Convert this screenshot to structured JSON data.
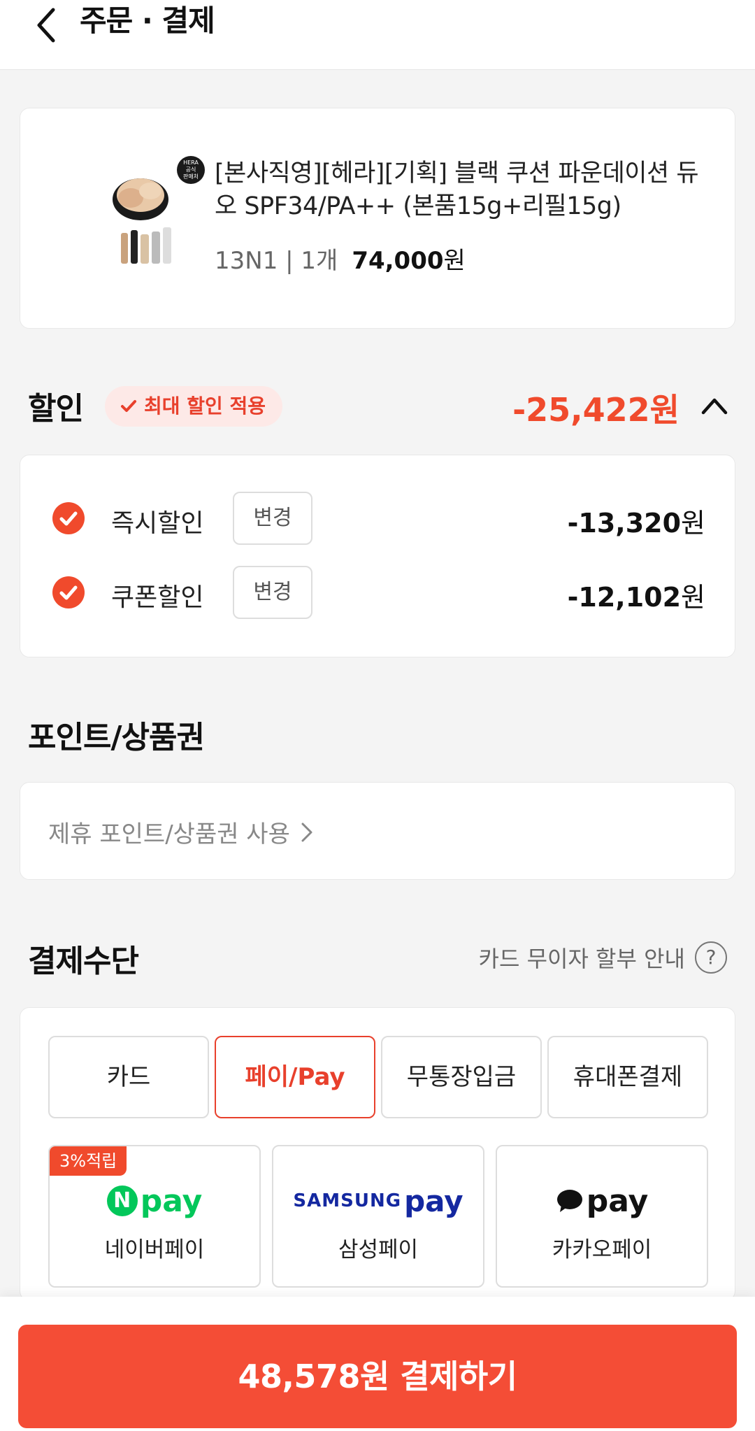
{
  "header": {
    "title": "주문 · 결제"
  },
  "product": {
    "name": "[본사직영][헤라][기획] 블랙 쿠션 파운데이션 듀오 SPF34/PA++ (본품15g+리필15g)",
    "option": "13N1 | 1개",
    "price": "74,000",
    "price_unit": "원",
    "thumb_badge": [
      "HERA",
      "공식",
      "판매처"
    ]
  },
  "discount": {
    "title": "할인",
    "badge_label": "최대 할인 적용",
    "total": "-25,422원",
    "rows": [
      {
        "label": "즉시할인",
        "change_label": "변경",
        "amount": "-13,320",
        "unit": "원"
      },
      {
        "label": "쿠폰할인",
        "change_label": "변경",
        "amount": "-12,102",
        "unit": "원"
      }
    ]
  },
  "points": {
    "title": "포인트/상품권",
    "link_label": "제휴 포인트/상품권 사용"
  },
  "payment": {
    "title": "결제수단",
    "installment_label": "카드 무이자 할부 안내",
    "help_glyph": "?",
    "tabs": [
      {
        "label": "카드",
        "active": false
      },
      {
        "label": "페이/Pay",
        "active": true
      },
      {
        "label": "무통장입금",
        "active": false
      },
      {
        "label": "휴대폰결제",
        "active": false
      }
    ],
    "options": [
      {
        "label": "네이버페이",
        "tag": "3%적립",
        "logo_text": "pay",
        "logo_letter": "N"
      },
      {
        "label": "삼성페이",
        "logo_text": "SAMSUNG",
        "logo_pay": "pay"
      },
      {
        "label": "카카오페이",
        "logo_text": "pay"
      }
    ]
  },
  "footer": {
    "pay_button": "48,578원 결제하기"
  },
  "colors": {
    "accent": "#f04a2c",
    "button": "#f44d36",
    "naver": "#03c75a",
    "samsung": "#1428a0"
  }
}
